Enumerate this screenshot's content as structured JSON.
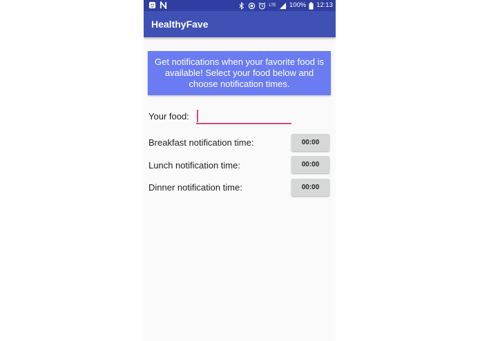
{
  "status_bar": {
    "battery": "100%",
    "time": "12:13",
    "network": "LTE",
    "icons": [
      "notification-app-icon",
      "n-icon",
      "bluetooth-icon",
      "hotspot-icon",
      "alarm-icon",
      "signal-icon",
      "battery-icon"
    ]
  },
  "app_bar": {
    "title": "HealthyFave",
    "color": "#3f51b5"
  },
  "banner": {
    "text": "Get notifications when your favorite food is available! Select your food below and choose notification times.",
    "color": "#6b7cf2"
  },
  "food": {
    "label": "Your food:",
    "value": "",
    "accent": "#d9447a"
  },
  "notifications": [
    {
      "label": "Breakfast notification time:",
      "time": "00:00"
    },
    {
      "label": "Lunch notification time:",
      "time": "00:00"
    },
    {
      "label": "Dinner notification time:",
      "time": "00:00"
    }
  ]
}
